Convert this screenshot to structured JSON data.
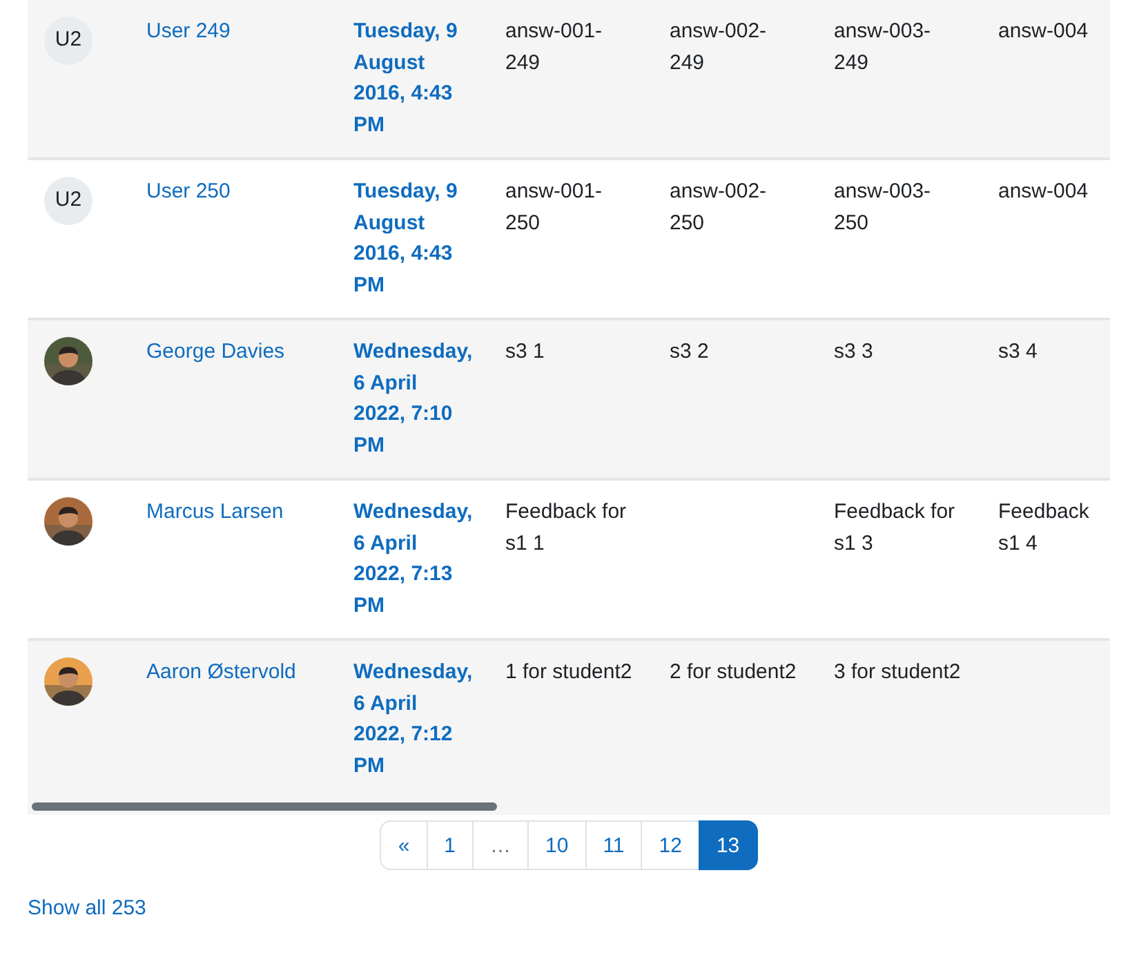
{
  "table": {
    "rows": [
      {
        "avatar": {
          "kind": "initials",
          "text": "U2"
        },
        "name": "User 249",
        "date": "Tuesday, 9 August 2016, 4:43 PM",
        "column_4": "answ-001-249",
        "column_5": "answ-002-249",
        "column_6": "answ-003-249",
        "column_7": "answ-004"
      },
      {
        "avatar": {
          "kind": "initials",
          "text": "U2"
        },
        "name": "User 250",
        "date": "Tuesday, 9 August 2016, 4:43 PM",
        "column_4": "answ-001-250",
        "column_5": "answ-002-250",
        "column_6": "answ-003-250",
        "column_7": "answ-004"
      },
      {
        "name": "George Davies",
        "date": "Wednesday, 6 April 2022, 7:10 PM",
        "column_4": "s3 1",
        "column_5": "s3 2",
        "column_6": "s3 3",
        "column_7": "s3 4"
      },
      {
        "name": "Marcus Larsen",
        "date": "Wednesday, 6 April 2022, 7:13 PM",
        "column_4": "Feedback for s1 1",
        "column_6": "Feedback for s1 3",
        "column_7": "Feedback s1 4"
      },
      {
        "name": "Aaron Østervold",
        "date": "Wednesday, 6 April 2022, 7:12 PM",
        "column_4": "1 for student2",
        "column_5": "2 for student2",
        "column_6": "3 for student2"
      }
    ]
  },
  "pagination": [
    {
      "label": "«",
      "kind": "page",
      "selected": false
    },
    {
      "label": "1",
      "kind": "page",
      "selected": false
    },
    {
      "label": "…",
      "kind": "gap",
      "selected": false
    },
    {
      "label": "10",
      "kind": "page",
      "selected": false
    },
    {
      "label": "11",
      "kind": "page",
      "selected": false
    },
    {
      "label": "12",
      "kind": "page",
      "selected": false
    },
    {
      "label": "13",
      "kind": "page",
      "selected": true
    }
  ],
  "show_all": "Show all 253"
}
